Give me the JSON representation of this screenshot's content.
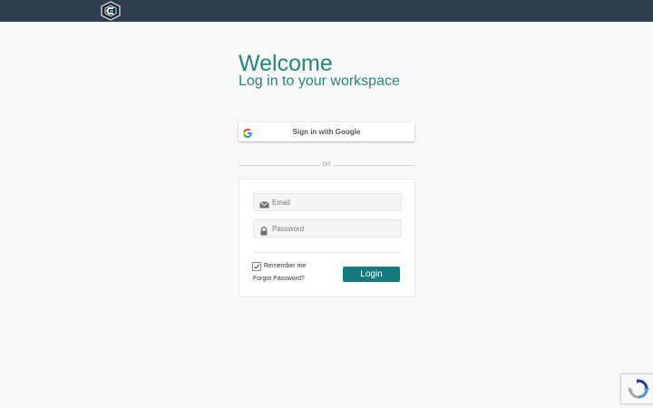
{
  "header": {
    "logo_icon": "hexagon-logo-icon",
    "background": "#2d3e50"
  },
  "main": {
    "title": "Welcome",
    "subtitle": "Log in to your workspace",
    "accent_color": "#26857e"
  },
  "google_signin": {
    "label": "Sign in with Google",
    "icon": "google-g-icon"
  },
  "separator": {
    "text": "OR"
  },
  "login_form": {
    "email": {
      "placeholder": "Email",
      "value": "",
      "icon": "envelope-icon"
    },
    "password": {
      "placeholder": "Password",
      "value": "",
      "icon": "lock-icon"
    },
    "remember_me": {
      "label": "Remember me",
      "checked": true
    },
    "forgot_password_label": "Forgot Password?",
    "login_label": "Login",
    "login_button_color": "#157a7f"
  },
  "recaptcha": {
    "icon": "recaptcha-icon"
  }
}
